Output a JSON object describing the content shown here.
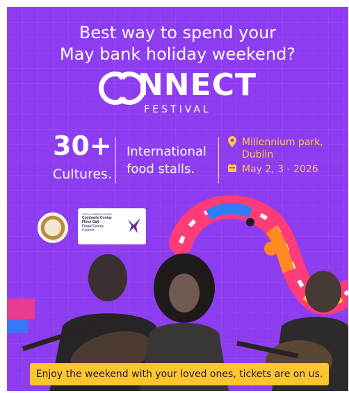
{
  "headline": {
    "line1": "Best way to spend your",
    "line2": "May bank holiday weekend?"
  },
  "logo": {
    "word_tail": "NNECT",
    "subtitle": "FESTIVAL"
  },
  "stats": {
    "number": "30+",
    "number_label": "Cultures.",
    "stalls_line1": "International",
    "stalls_line2": "food stalls."
  },
  "event": {
    "location_line1": "Millennium park,",
    "location_line2": "Dublin",
    "date": "May 2, 3 - 2026",
    "location_icon": "map-pin-icon",
    "date_icon": "calendar-icon"
  },
  "sponsors": {
    "funding_small": "WITH FUNDING FROM",
    "funding_line1": "Comhairle Contae",
    "funding_line2": "Fhine Gall",
    "funding_line3": "Fingal County",
    "funding_line4": "Council"
  },
  "banner": {
    "text": "Enjoy the weekend with your loved ones, tickets are on us."
  },
  "colors": {
    "background": "#8d3cf0",
    "accent_yellow": "#ffc940",
    "banner": "#ffc52e",
    "text": "#ffffff"
  }
}
